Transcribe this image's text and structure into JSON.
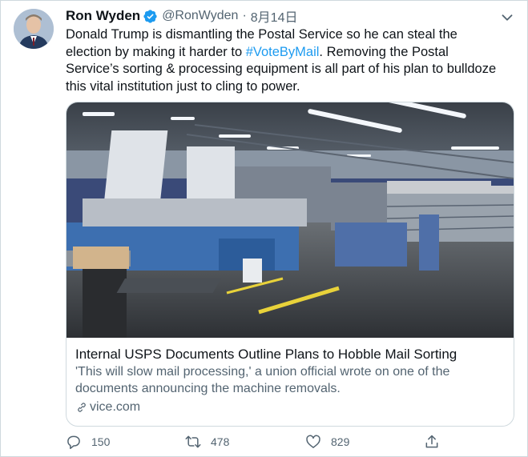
{
  "author": {
    "name": "Ron Wyden",
    "handle": "@RonWyden",
    "separator": "·",
    "date": "8月14日"
  },
  "tweet": {
    "text_before": "Donald Trump is dismantling the Postal Service so he can steal the election by making it harder to ",
    "hashtag": "#VoteByMail",
    "text_after": ". Removing the Postal Service’s sorting & processing equipment is all part of his plan to bulldoze this vital institution just to cling to power."
  },
  "card": {
    "title": "Internal USPS Documents Outline Plans to Hobble Mail Sorting",
    "description": "'This will slow mail processing,' a union official wrote on one of the documents announcing the machine removals.",
    "domain": "vice.com",
    "image_icon": "mail-sorting-facility-photo"
  },
  "actions": {
    "reply_count": "150",
    "retweet_count": "478",
    "like_count": "829"
  },
  "icons": {
    "verified": "verified-badge-icon",
    "caret": "chevron-down-icon",
    "reply": "reply-icon",
    "retweet": "retweet-icon",
    "like": "heart-icon",
    "share": "share-icon",
    "link": "link-icon"
  },
  "colors": {
    "accent": "#1d9bf0",
    "text": "#0f1419",
    "secondary": "#536471",
    "border": "#cfd9de"
  }
}
